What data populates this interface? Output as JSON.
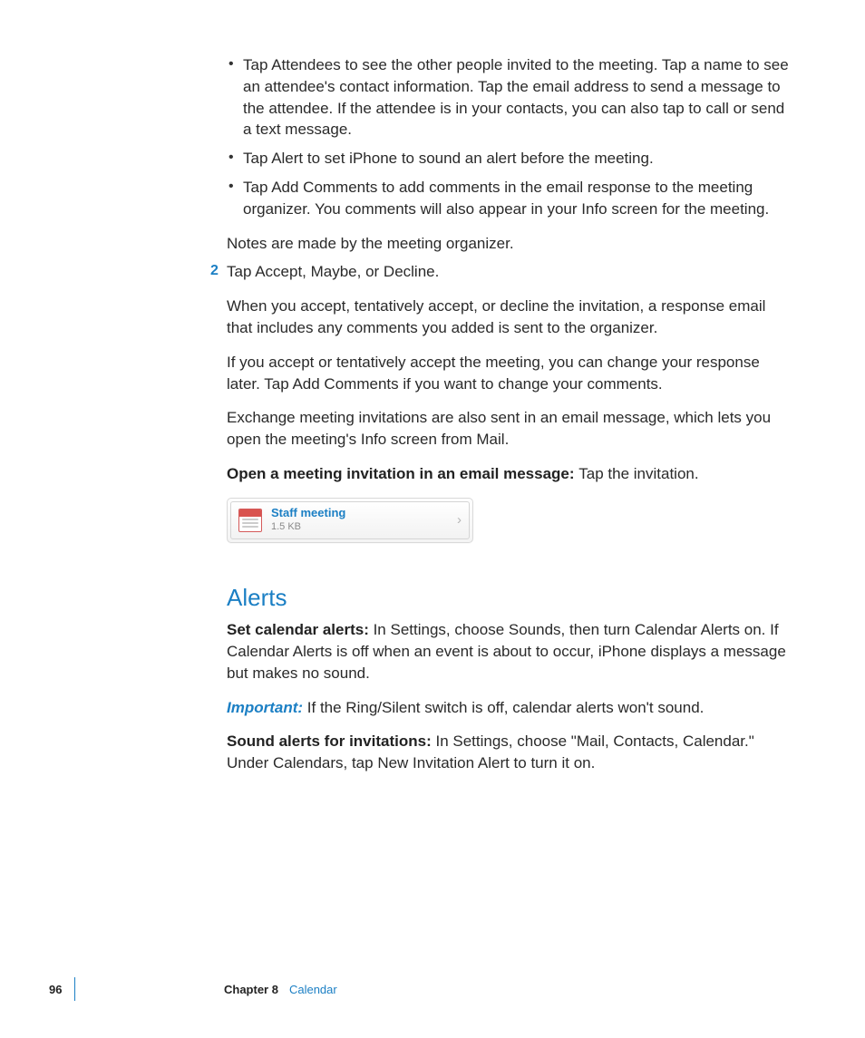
{
  "bullets": [
    "Tap Attendees to see the other people invited to the meeting. Tap a name to see an attendee's contact information. Tap the email address to send a message to the attendee. If the attendee is in your contacts, you can also tap to call or send a text message.",
    "Tap Alert to set iPhone to sound an alert before the meeting.",
    "Tap Add Comments to add comments in the email response to the meeting organizer. You comments will also appear in your Info screen for the meeting."
  ],
  "notes_line": "Notes are made by the meeting organizer.",
  "step2": {
    "number": "2",
    "text": "Tap Accept, Maybe, or Decline."
  },
  "para1": "When you accept, tentatively accept, or decline the invitation, a response email that includes any comments you added is sent to the organizer.",
  "para2": "If you accept or tentatively accept the meeting, you can change your response later. Tap Add Comments if you want to change your comments.",
  "para3": "Exchange meeting invitations are also sent in an email message, which lets you open the meeting's Info screen from Mail.",
  "open_label": "Open a meeting invitation in an email message:  ",
  "open_action": "Tap the invitation.",
  "attachment": {
    "title": "Staff meeting",
    "size": "1.5 KB"
  },
  "alerts_heading": "Alerts",
  "set_alerts_label": "Set calendar alerts:  ",
  "set_alerts_text": "In Settings, choose Sounds, then turn Calendar Alerts on. If Calendar Alerts is off when an event is about to occur, iPhone displays a message but makes no sound.",
  "important_label": "Important:  ",
  "important_text": "If the Ring/Silent switch is off, calendar alerts won't sound.",
  "sound_label": "Sound alerts for invitations:  ",
  "sound_text": "In Settings, choose \"Mail, Contacts, Calendar.\" Under Calendars, tap New Invitation Alert to turn it on.",
  "footer": {
    "page": "96",
    "chapter_label": "Chapter 8",
    "chapter_name": "Calendar"
  }
}
